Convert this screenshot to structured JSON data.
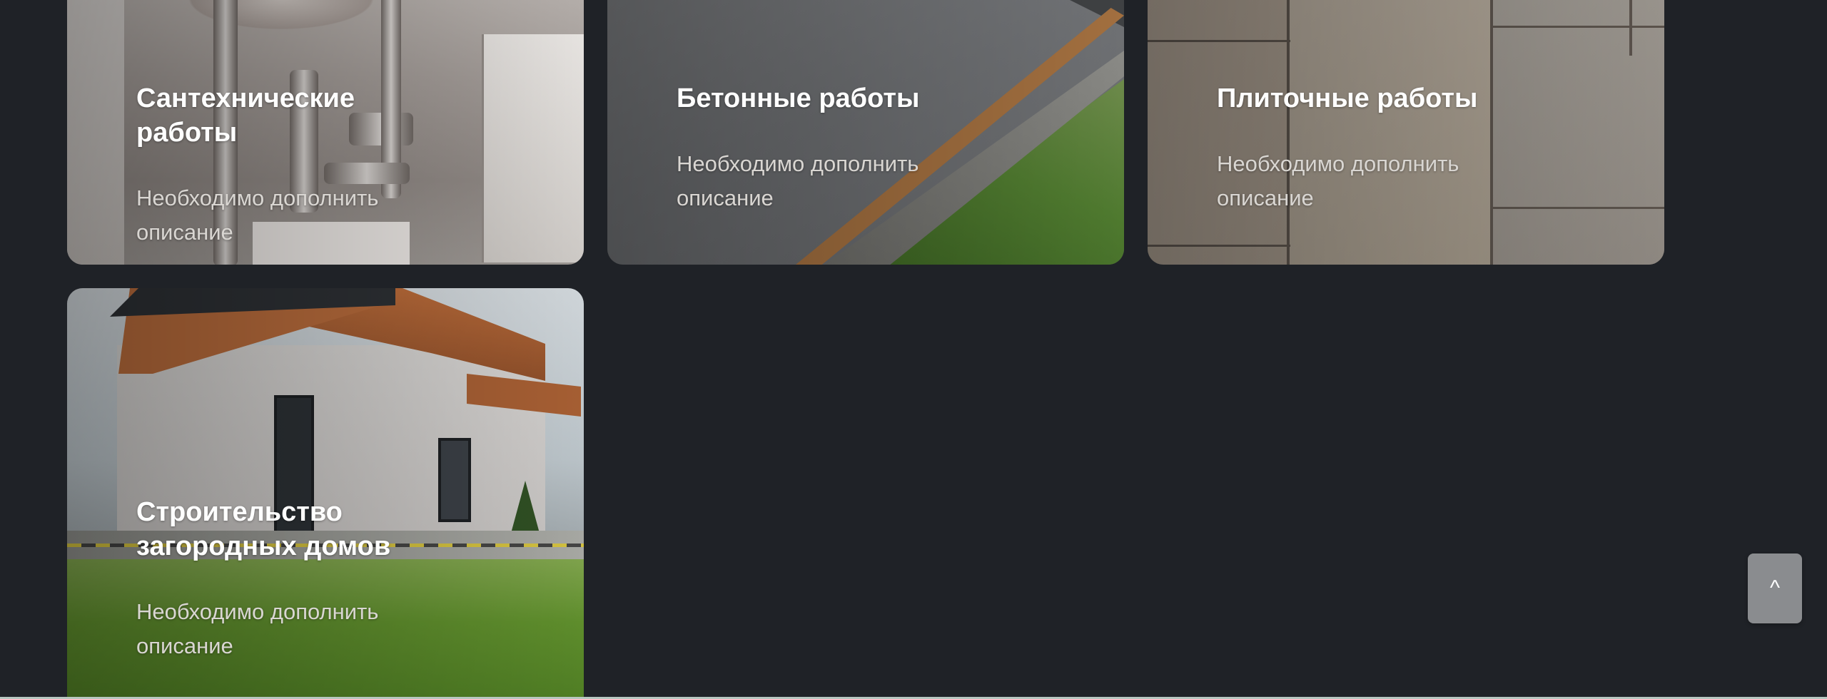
{
  "services": [
    {
      "title": "Сантехнические работы",
      "description": "Необходимо дополнить описание",
      "image": "plumbing-photo"
    },
    {
      "title": "Бетонные работы",
      "description": "Необходимо дополнить описание",
      "image": "concrete-photo"
    },
    {
      "title": "Плиточные работы",
      "description": "Необходимо дополнить описание",
      "image": "tiles-photo"
    },
    {
      "title": "Строительство загородных домов",
      "description": "Необходимо дополнить описание",
      "image": "house-photo"
    }
  ],
  "scroll_top": {
    "label": "^"
  },
  "colors": {
    "page_background": "#1f2227",
    "title_text": "#ffffff",
    "description_text": "#d9d6d2",
    "scroll_button": "#8a8c8f"
  }
}
